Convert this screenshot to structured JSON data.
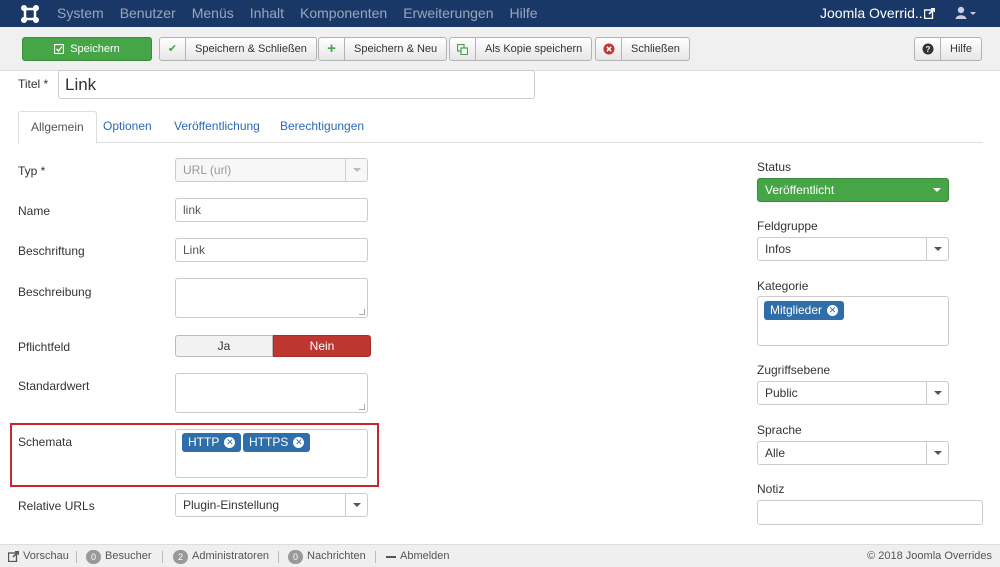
{
  "navbar": {
    "menu": [
      "System",
      "Benutzer",
      "Menüs",
      "Inhalt",
      "Komponenten",
      "Erweiterungen",
      "Hilfe"
    ],
    "site_title": "Joomla Overrid...",
    "icons": {
      "logo": "joomla-logo-icon",
      "external": "external-link-icon",
      "user": "user-icon"
    }
  },
  "toolbar": {
    "save": "Speichern",
    "save_close": "Speichern & Schließen",
    "save_new": "Speichern & Neu",
    "save_copy": "Als Kopie speichern",
    "close": "Schließen",
    "help": "Hilfe"
  },
  "title": {
    "label": "Titel *",
    "value": "Link"
  },
  "tabs": [
    "Allgemein",
    "Optionen",
    "Veröffentlichung",
    "Berechtigungen"
  ],
  "form": {
    "type": {
      "label": "Typ *",
      "value": "URL (url)"
    },
    "name": {
      "label": "Name",
      "value": "link"
    },
    "caption": {
      "label": "Beschriftung",
      "value": "Link"
    },
    "description": {
      "label": "Beschreibung",
      "value": ""
    },
    "required": {
      "label": "Pflichtfeld",
      "yes": "Ja",
      "no": "Nein",
      "selected": "Nein"
    },
    "default": {
      "label": "Standardwert",
      "value": ""
    },
    "schemes": {
      "label": "Schemata",
      "tags": [
        "HTTP",
        "HTTPS"
      ]
    },
    "relative": {
      "label": "Relative URLs",
      "value": "Plugin-Einstellung"
    }
  },
  "sidebar": {
    "status": {
      "label": "Status",
      "value": "Veröffentlicht"
    },
    "fieldgroup": {
      "label": "Feldgruppe",
      "value": "Infos"
    },
    "category": {
      "label": "Kategorie",
      "tag": "Mitglieder"
    },
    "access": {
      "label": "Zugriffsebene",
      "value": "Public"
    },
    "language": {
      "label": "Sprache",
      "value": "Alle"
    },
    "note": {
      "label": "Notiz",
      "value": ""
    }
  },
  "footer": {
    "preview": "Vorschau",
    "visitors": {
      "count": "0",
      "label": "Besucher"
    },
    "admins": {
      "count": "2",
      "label": "Administratoren"
    },
    "messages": {
      "count": "0",
      "label": "Nachrichten"
    },
    "logout": "Abmelden",
    "copyright": "© 2018 Joomla Overrides"
  },
  "colors": {
    "navbar": "#1a3867",
    "success": "#46a546",
    "danger": "#bd362f",
    "tag": "#2f6ea8",
    "link": "#2a69b8",
    "highlight": "#c9262c"
  }
}
